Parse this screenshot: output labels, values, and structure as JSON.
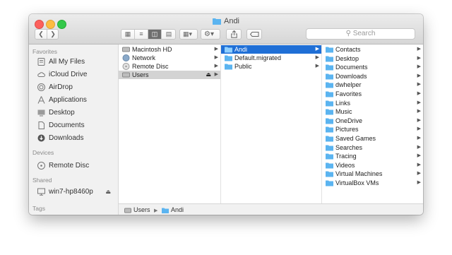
{
  "window": {
    "title": "Andi",
    "search_placeholder": "Search"
  },
  "toolbar": {
    "back_icon": "chevron-left-icon",
    "forward_icon": "chevron-right-icon",
    "view_modes": [
      "icon-view",
      "list-view",
      "column-view",
      "cover-flow-view"
    ],
    "active_view": "column-view"
  },
  "sidebar": {
    "favorites_heading": "Favorites",
    "favorites": [
      {
        "label": "All My Files",
        "icon": "all-files-icon"
      },
      {
        "label": "iCloud Drive",
        "icon": "cloud-icon"
      },
      {
        "label": "AirDrop",
        "icon": "airdrop-icon"
      },
      {
        "label": "Applications",
        "icon": "applications-icon"
      },
      {
        "label": "Desktop",
        "icon": "desktop-icon"
      },
      {
        "label": "Documents",
        "icon": "documents-icon"
      },
      {
        "label": "Downloads",
        "icon": "downloads-icon"
      }
    ],
    "devices_heading": "Devices",
    "devices": [
      {
        "label": "Remote Disc",
        "icon": "disc-icon"
      }
    ],
    "shared_heading": "Shared",
    "shared": [
      {
        "label": "win7-hp8460p",
        "icon": "display-icon"
      }
    ],
    "tags_heading": "Tags"
  },
  "columns": {
    "col1": [
      {
        "label": "Macintosh HD",
        "icon": "harddrive-icon"
      },
      {
        "label": "Network",
        "icon": "network-icon"
      },
      {
        "label": "Remote Disc",
        "icon": "disc-icon"
      },
      {
        "label": "Users",
        "icon": "harddrive-icon",
        "selected": "gray"
      }
    ],
    "col2": [
      {
        "label": "Andi",
        "icon": "folder-icon",
        "selected": "blue"
      },
      {
        "label": "Default.migrated",
        "icon": "folder-icon"
      },
      {
        "label": "Public",
        "icon": "folder-icon"
      }
    ],
    "col3": [
      {
        "label": "Contacts"
      },
      {
        "label": "Desktop"
      },
      {
        "label": "Documents"
      },
      {
        "label": "Downloads"
      },
      {
        "label": "dwhelper"
      },
      {
        "label": "Favorites"
      },
      {
        "label": "Links"
      },
      {
        "label": "Music"
      },
      {
        "label": "OneDrive"
      },
      {
        "label": "Pictures"
      },
      {
        "label": "Saved Games"
      },
      {
        "label": "Searches"
      },
      {
        "label": "Tracing"
      },
      {
        "label": "Videos"
      },
      {
        "label": "Virtual Machines"
      },
      {
        "label": "VirtualBox VMs"
      }
    ]
  },
  "pathbar": {
    "items": [
      "Users",
      "Andi"
    ]
  },
  "colors": {
    "selection_blue": "#1f6fd6",
    "selection_gray": "#d3d3d3",
    "folder_blue": "#5bb4f0"
  }
}
